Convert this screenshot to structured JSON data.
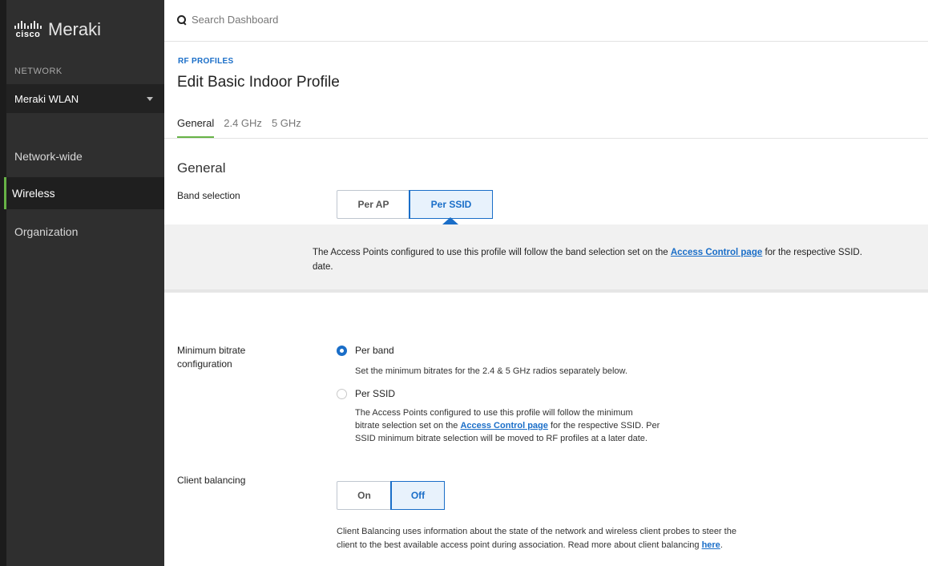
{
  "brand": {
    "cisco": "cisco",
    "name": "Meraki"
  },
  "sidebar": {
    "network_heading": "NETWORK",
    "network_value": "Meraki WLAN",
    "items": [
      {
        "label": "Network-wide"
      },
      {
        "label": "Wireless",
        "active": true
      },
      {
        "label": "Organization"
      }
    ]
  },
  "search": {
    "placeholder": "Search Dashboard"
  },
  "header": {
    "eyebrow": "RF PROFILES",
    "title": "Edit Basic Indoor Profile",
    "tabs": [
      {
        "label": "General",
        "active": true
      },
      {
        "label": "2.4 GHz"
      },
      {
        "label": "5 GHz"
      }
    ]
  },
  "general": {
    "section_title": "General",
    "band_selection": {
      "label": "Band selection",
      "options": [
        "Per AP",
        "Per SSID"
      ],
      "selected": "Per SSID",
      "info_before": "The Access Points configured to use this profile will follow the band selection set on the ",
      "info_link": "Access Control page",
      "info_after": " for the respective SSID.",
      "info_line2": "date."
    },
    "min_bitrate": {
      "label_line1": "Minimum bitrate",
      "label_line2": "configuration",
      "option1_label": "Per band",
      "option1_desc": "Set the minimum bitrates for the 2.4 & 5 GHz radios separately below.",
      "option2_label": "Per SSID",
      "option2_desc_line1": "The Access Points configured to use this profile will follow the minimum",
      "option2_desc_before": "bitrate selection set on the ",
      "option2_desc_link": "Access Control page",
      "option2_desc_after": " for the respective SSID. Per",
      "option2_desc_line3": "SSID minimum bitrate selection will be moved to RF profiles at a later date.",
      "selected": "Per band"
    },
    "client_balancing": {
      "label": "Client balancing",
      "options": [
        "On",
        "Off"
      ],
      "selected": "Off",
      "desc_line1": "Client Balancing uses information about the state of the network and wireless client probes to steer the",
      "desc_before": "client to the best available access point during association. Read more about client balancing ",
      "desc_link": "here",
      "desc_after": "."
    }
  },
  "colors": {
    "accent": "#1a6ec8",
    "active_nav": "#67b346",
    "sidebar_bg": "#2f2f2f"
  }
}
